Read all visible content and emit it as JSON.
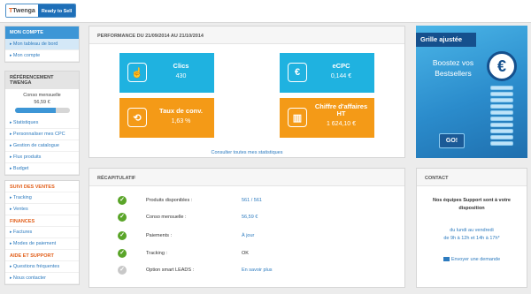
{
  "brand": {
    "logo_name": "Twenga",
    "logo_initial": "T",
    "tagline": "Ready to Sell"
  },
  "sidebar": {
    "account": {
      "heading": "MON COMPTE",
      "items": [
        "Mon tableau de bord",
        "Mon compte"
      ]
    },
    "referencing": {
      "heading": "RÉFÉRENCEMENT TWENGA",
      "conso_label": "Conso mensuelle",
      "conso_value": "56,59 €",
      "conso_progress": 0.75,
      "items": [
        "Statistiques",
        "Personnaliser mes CPC",
        "Gestion de catalogue",
        "Flux produits",
        "Budget"
      ]
    },
    "ventes": {
      "heading": "SUIVI DES VENTES",
      "items": [
        "Tracking",
        "Ventes"
      ]
    },
    "finances": {
      "heading": "FINANCES",
      "items": [
        "Factures",
        "Modes de paiement"
      ]
    },
    "aide": {
      "heading": "AIDE ET SUPPORT",
      "items": [
        "Questions fréquentes",
        "Nous contacter"
      ]
    }
  },
  "performance": {
    "title": "PERFORMANCE DU 21/09/2014 AU 21/10/2014",
    "tiles": [
      {
        "label": "Clics",
        "value": "430",
        "color": "#1fb2e0",
        "icon": "pointer-icon",
        "glyph": "☝"
      },
      {
        "label": "eCPC",
        "value": "0,144 €",
        "color": "#1fb2e0",
        "icon": "euro-icon",
        "glyph": "€"
      },
      {
        "label": "Taux de conv.",
        "value": "1,63 %",
        "color": "#f49a17",
        "icon": "refresh-icon",
        "glyph": "⟲"
      },
      {
        "label": "Chiffre d'affaires HT",
        "value": "1 624,10 €",
        "color": "#f49a17",
        "icon": "bar-chart-icon",
        "glyph": "▥"
      }
    ],
    "link": "Consulter toutes mes statistiques"
  },
  "recap": {
    "title": "RÉCAPITULATIF",
    "rows": [
      {
        "label": "Produits disponibles :",
        "value": "561 / 561",
        "status": "ok"
      },
      {
        "label": "Conso mensuelle :",
        "value": "56,59 €",
        "status": "ok"
      },
      {
        "label": "Paiements :",
        "value": "À jour",
        "status": "ok"
      },
      {
        "label": "Tracking :",
        "value": "OK",
        "status": "ok"
      },
      {
        "label": "Option smart LEADS :",
        "value": "En savoir plus",
        "status": "inactive"
      }
    ]
  },
  "ad": {
    "ribbon": "Grille ajustée",
    "line1": "Boostez vos",
    "line2": "Bestsellers",
    "button": "GO!",
    "coin": "€"
  },
  "contact": {
    "title": "CONTACT",
    "text_line1": "Nos équipes Support sont à votre",
    "text_line2": "disposition",
    "hours_line1": "du lundi au vendredi",
    "hours_line2": "de 9h à 12h et 14h à 17h*",
    "link": "Envoyer une demande"
  },
  "colors": {
    "accent_blue": "#3d96d6",
    "tile_blue": "#1fb2e0",
    "tile_orange": "#f49a17",
    "link": "#2d7bbf",
    "section_orange": "#e2601c",
    "check_green": "#5aa529"
  }
}
